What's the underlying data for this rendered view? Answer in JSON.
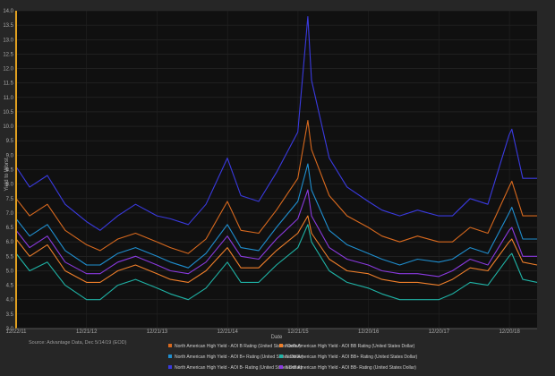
{
  "chart_data": {
    "type": "line",
    "title": "",
    "xlabel": "Date",
    "ylabel": "Yield to Worst",
    "ylim": [
      3.0,
      14.0
    ],
    "y_ticks": [
      3.0,
      3.5,
      4.0,
      4.5,
      5.0,
      5.5,
      6.0,
      6.5,
      7.0,
      7.5,
      8.0,
      8.5,
      9.0,
      9.5,
      10.0,
      10.5,
      11.0,
      11.5,
      12.0,
      12.5,
      13.0,
      13.5,
      14.0
    ],
    "x_tick_labels": [
      "12/22/11",
      "12/21/12",
      "12/21/13",
      "12/21/14",
      "12/21/15",
      "12/20/16",
      "12/20/17",
      "12/20/18"
    ],
    "grid": true,
    "legend_position": "bottom",
    "source": "Source: Advantage Data, Dec 5/14/19 (EOD)",
    "x": [
      "2011-12-22",
      "2012-03-01",
      "2012-06-01",
      "2012-09-01",
      "2012-12-21",
      "2013-03-01",
      "2013-06-01",
      "2013-09-01",
      "2013-12-21",
      "2014-03-01",
      "2014-06-01",
      "2014-09-01",
      "2014-12-21",
      "2015-03-01",
      "2015-06-01",
      "2015-09-01",
      "2015-12-21",
      "2016-02-11",
      "2016-03-01",
      "2016-06-01",
      "2016-09-01",
      "2016-12-20",
      "2017-03-01",
      "2017-06-01",
      "2017-09-01",
      "2017-12-20",
      "2018-03-01",
      "2018-06-01",
      "2018-09-01",
      "2018-12-20",
      "2019-01-03",
      "2019-03-01",
      "2019-05-14"
    ],
    "series": [
      {
        "name": "North American High Yield - AOI B Rating (United States Dollar)",
        "color": "#d8691e",
        "values": [
          7.5,
          6.9,
          7.3,
          6.4,
          5.9,
          5.7,
          6.1,
          6.3,
          6.0,
          5.8,
          5.6,
          6.1,
          7.4,
          6.4,
          6.3,
          7.1,
          8.2,
          10.2,
          9.2,
          7.6,
          6.9,
          6.5,
          6.2,
          6.0,
          6.2,
          6.0,
          6.0,
          6.5,
          6.3,
          7.9,
          8.1,
          6.9,
          6.9
        ]
      },
      {
        "name": "North American High Yield - AOI BB Rating (United States Dollar)",
        "color": "#f07f2a",
        "values": [
          6.1,
          5.5,
          5.9,
          5.0,
          4.6,
          4.6,
          5.0,
          5.2,
          4.9,
          4.7,
          4.6,
          5.0,
          5.8,
          5.1,
          5.1,
          5.7,
          6.3,
          6.9,
          6.3,
          5.4,
          5.0,
          4.9,
          4.7,
          4.6,
          4.6,
          4.5,
          4.7,
          5.1,
          5.0,
          6.0,
          6.1,
          5.3,
          5.2
        ]
      },
      {
        "name": "North American High Yield - AOI B+ Rating (United States Dollar)",
        "color": "#1f8fd0",
        "values": [
          6.8,
          6.2,
          6.6,
          5.7,
          5.2,
          5.2,
          5.6,
          5.8,
          5.5,
          5.3,
          5.1,
          5.6,
          6.6,
          5.8,
          5.7,
          6.5,
          7.4,
          8.7,
          7.8,
          6.4,
          5.9,
          5.6,
          5.4,
          5.2,
          5.4,
          5.3,
          5.4,
          5.8,
          5.6,
          7.0,
          7.2,
          6.1,
          6.1
        ]
      },
      {
        "name": "North American High Yield - AOI BB+ Rating (United States Dollar)",
        "color": "#1fb3a6",
        "values": [
          5.6,
          5.0,
          5.3,
          4.5,
          4.0,
          4.0,
          4.5,
          4.7,
          4.4,
          4.2,
          4.0,
          4.4,
          5.3,
          4.6,
          4.6,
          5.2,
          5.8,
          6.6,
          6.0,
          5.0,
          4.6,
          4.4,
          4.2,
          4.0,
          4.0,
          4.0,
          4.2,
          4.6,
          4.5,
          5.5,
          5.6,
          4.7,
          4.6
        ]
      },
      {
        "name": "North American High Yield - AOI B- Rating (United States Dollar)",
        "color": "#3a3ae0",
        "values": [
          8.6,
          7.9,
          8.3,
          7.3,
          6.7,
          6.4,
          6.9,
          7.3,
          6.9,
          6.8,
          6.6,
          7.3,
          8.9,
          7.6,
          7.4,
          8.4,
          9.8,
          13.8,
          11.6,
          8.9,
          7.9,
          7.4,
          7.1,
          6.9,
          7.1,
          6.9,
          6.9,
          7.5,
          7.3,
          9.7,
          9.9,
          8.2,
          8.2
        ]
      },
      {
        "name": "North American High Yield - AOI BB- Rating (United States Dollar)",
        "color": "#8a3ae0",
        "values": [
          6.4,
          5.8,
          6.2,
          5.3,
          4.9,
          4.9,
          5.3,
          5.5,
          5.2,
          5.0,
          4.9,
          5.3,
          6.2,
          5.5,
          5.4,
          6.1,
          6.8,
          7.8,
          6.9,
          5.8,
          5.4,
          5.2,
          5.0,
          4.9,
          4.9,
          4.8,
          5.0,
          5.4,
          5.2,
          6.4,
          6.5,
          5.5,
          5.5
        ]
      }
    ]
  }
}
